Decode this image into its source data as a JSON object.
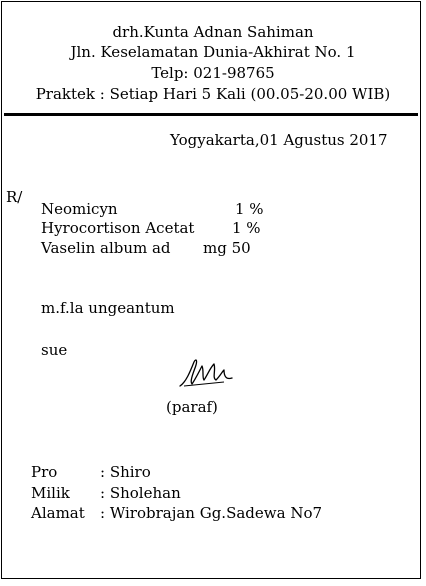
{
  "header": {
    "name": "drh.Kunta Adnan Sahiman",
    "address": "Jln. Keselamatan Dunia-Akhirat No. 1",
    "phone": "Telp: 021-98765",
    "hours": "Praktek : Setiap Hari 5 Kali (00.05-20.00 WIB)"
  },
  "place_date": "Yogyakarta,01 Agustus 2017",
  "recipe_mark": "R/",
  "ingredients": [
    {
      "name": "Neomicyn",
      "amount": "1 %"
    },
    {
      "name": "Hyrocortison Acetat",
      "amount": "1 %"
    },
    {
      "name": "Vaselin album ad",
      "amount": "mg 50"
    }
  ],
  "instruction": "m.f.la ungeantum",
  "signa": "sue",
  "paraf_label": "(paraf)",
  "patient": {
    "pro_label": "Pro",
    "pro_value": ": Shiro",
    "owner_label": "Milik",
    "owner_value": ": Sholehan",
    "address_label": "Alamat",
    "address_value": ": Wirobrajan Gg.Sadewa No7"
  }
}
